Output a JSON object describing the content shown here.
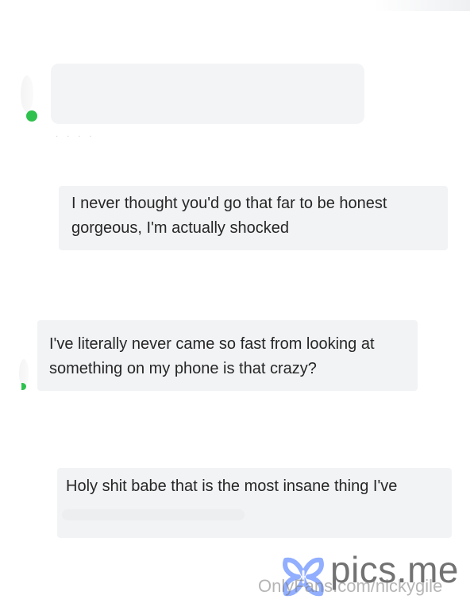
{
  "thread": {
    "timestamp": "· · · ·",
    "messages": [
      {
        "text": ""
      },
      {
        "text": "I never thought you'd go that far to be honest gorgeous, I'm actually shocked"
      },
      {
        "text": "I've literally never came so fast from looking at something on my phone is that crazy?"
      },
      {
        "text": "Holy shit babe that is the most insane thing I've"
      }
    ]
  },
  "watermark": {
    "brand": "pics.me",
    "url": "OnlyFans.com/nickygile",
    "logo_icon": "x-butterfly-logo-icon",
    "logo_color": "#7ea0ff"
  },
  "colors": {
    "bubble": "#f2f3f5",
    "online": "#2fc14e"
  }
}
